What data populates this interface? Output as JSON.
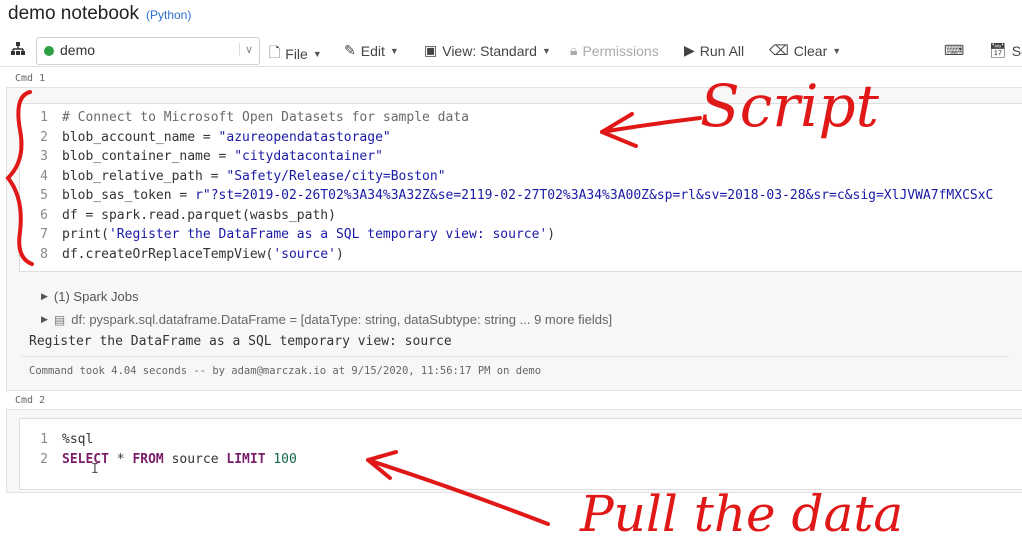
{
  "notebook": {
    "title": "demo notebook",
    "language": "(Python)"
  },
  "toolbar": {
    "cluster": "demo",
    "file": "File",
    "edit": "Edit",
    "view": "View: Standard",
    "permissions": "Permissions",
    "run_all": "Run All",
    "clear": "Clear",
    "schedule": "Sc"
  },
  "cells": [
    {
      "label": "Cmd 1",
      "lines": [
        {
          "n": "1",
          "parts": [
            {
              "t": "# Connect to Microsoft Open Datasets for sample data",
              "c": "com"
            }
          ]
        },
        {
          "n": "2",
          "parts": [
            {
              "t": "blob_account_name = "
            },
            {
              "t": "\"azureopendatastorage\"",
              "c": "str"
            }
          ]
        },
        {
          "n": "3",
          "parts": [
            {
              "t": "blob_container_name = "
            },
            {
              "t": "\"citydatacontainer\"",
              "c": "str"
            }
          ]
        },
        {
          "n": "4",
          "parts": [
            {
              "t": "blob_relative_path = "
            },
            {
              "t": "\"Safety/Release/city=Boston\"",
              "c": "str"
            }
          ]
        },
        {
          "n": "5",
          "parts": [
            {
              "t": "blob_sas_token = "
            },
            {
              "t": "r\"?st=2019-02-26T02%3A34%3A32Z&se=2119-02-27T02%3A34%3A00Z&sp=rl&sv=2018-03-28&sr=c&sig=XlJVWA7fMXCSxC",
              "c": "str"
            }
          ]
        },
        {
          "n": "6",
          "parts": [
            {
              "t": "df = spark.read.parquet(wasbs_path)"
            }
          ]
        },
        {
          "n": "7",
          "parts": [
            {
              "t": "print("
            },
            {
              "t": "'Register the DataFrame as a SQL temporary view: source'",
              "c": "str"
            },
            {
              "t": ")"
            }
          ]
        },
        {
          "n": "8",
          "parts": [
            {
              "t": "df.createOrReplaceTempView("
            },
            {
              "t": "'source'",
              "c": "str"
            },
            {
              "t": ")"
            }
          ]
        }
      ],
      "spark_jobs": "(1) Spark Jobs",
      "df_schema": "df:  pyspark.sql.dataframe.DataFrame = [dataType: string, dataSubtype: string ... 9 more fields]",
      "output": "Register the DataFrame as a SQL temporary view: source",
      "timing": "Command took 4.04 seconds -- by adam@marczak.io at 9/15/2020, 11:56:17 PM on demo"
    },
    {
      "label": "Cmd 2",
      "lines": [
        {
          "n": "1",
          "parts": [
            {
              "t": "%sql"
            }
          ]
        },
        {
          "n": "2",
          "parts": [
            {
              "t": "SELECT",
              "c": "kw"
            },
            {
              "t": " * "
            },
            {
              "t": "FROM",
              "c": "kw"
            },
            {
              "t": " source "
            },
            {
              "t": "LIMIT",
              "c": "kw"
            },
            {
              "t": " "
            },
            {
              "t": "100",
              "c": "num"
            }
          ]
        }
      ]
    }
  ],
  "annotations": {
    "script": "Script",
    "pull": "Pull the data",
    "color": "#e01818"
  }
}
